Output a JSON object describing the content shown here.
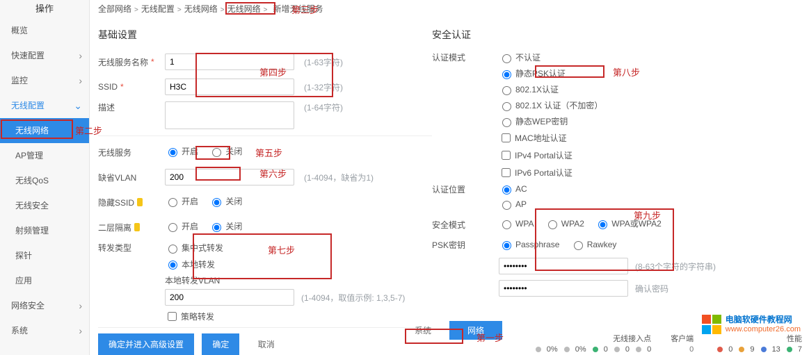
{
  "sidebar": {
    "title": "操作",
    "items": [
      {
        "label": "概览"
      },
      {
        "label": "快速配置",
        "expand": true
      },
      {
        "label": "监控",
        "expand": true
      },
      {
        "label": "无线配置",
        "expand": true,
        "open": true
      },
      {
        "label": "无线网络",
        "active": true,
        "sub": true
      },
      {
        "label": "AP管理",
        "sub": true
      },
      {
        "label": "无线QoS",
        "sub": true
      },
      {
        "label": "无线安全",
        "sub": true
      },
      {
        "label": "射频管理",
        "sub": true
      },
      {
        "label": "探针",
        "sub": true
      },
      {
        "label": "应用",
        "sub": true
      },
      {
        "label": "网络安全",
        "expand": true
      },
      {
        "label": "系统",
        "expand": true
      }
    ]
  },
  "breadcrumb": [
    "全部网络",
    "无线配置",
    "无线网络",
    "无线网络",
    "新增无线服务"
  ],
  "annotations": {
    "step1": "第一步",
    "step2": "第二步",
    "step3": "第三步",
    "step4": "第四步",
    "step5": "第五步",
    "step6": "第六步",
    "step7": "第七步",
    "step8": "第八步",
    "step9": "第九步"
  },
  "left": {
    "section": "基础设置",
    "service_name_label": "无线服务名称",
    "service_name_value": "1",
    "service_name_hint": "(1-63字符)",
    "ssid_label": "SSID",
    "ssid_value": "H3C",
    "ssid_hint": "(1-32字符)",
    "desc_label": "描述",
    "desc_hint": "(1-64字符)",
    "wireless_service_label": "无线服务",
    "on": "开启",
    "off": "关闭",
    "default_vlan_label": "缺省VLAN",
    "default_vlan_value": "200",
    "default_vlan_hint": "(1-4094，缺省为1)",
    "hide_ssid_label": "隐藏SSID",
    "l2_isolate_label": "二层隔离",
    "forward_type_label": "转发类型",
    "forward_central": "集中式转发",
    "forward_local": "本地转发",
    "local_vlan_label": "本地转发VLAN",
    "local_vlan_value": "200",
    "local_vlan_hint": "(1-4094，取值示例: 1,3,5-7)",
    "policy_forward": "策略转发"
  },
  "right": {
    "section": "安全认证",
    "auth_mode_label": "认证模式",
    "auth_none": "不认证",
    "auth_psk": "静态PSK认证",
    "auth_8021x": "802.1X认证",
    "auth_8021x_open": "802.1X 认证（不加密）",
    "auth_wep": "静态WEP密钥",
    "auth_mac": "MAC地址认证",
    "auth_v4portal": "IPv4 Portal认证",
    "auth_v6portal": "IPv6 Portal认证",
    "auth_loc_label": "认证位置",
    "auth_loc_ac": "AC",
    "auth_loc_ap": "AP",
    "sec_mode_label": "安全模式",
    "wpa": "WPA",
    "wpa2": "WPA2",
    "wpa_or": "WPA或WPA2",
    "psk_label": "PSK密钥",
    "passphrase": "Passphrase",
    "rawkey": "Rawkey",
    "psk_value": "••••••••",
    "psk_hint": "(8-63个字符的字符串)",
    "psk_confirm_value": "••••••••",
    "psk_confirm_hint": "确认密码"
  },
  "buttons": {
    "adv": "确定并进入高级设置",
    "ok": "确定",
    "cancel": "取消"
  },
  "bottom_tabs": {
    "sys": "系统",
    "net": "网络"
  },
  "status": {
    "wLabel": "无线接入点",
    "cLabel": "客户端",
    "pLabel": "性能",
    "w": [
      "0%",
      "0%",
      "0",
      "0",
      "0"
    ],
    "c": [
      "0",
      "9",
      "13",
      "7"
    ]
  },
  "watermark": {
    "line1": "电脑软硬件教程网",
    "line2": "www.computer26.com"
  }
}
